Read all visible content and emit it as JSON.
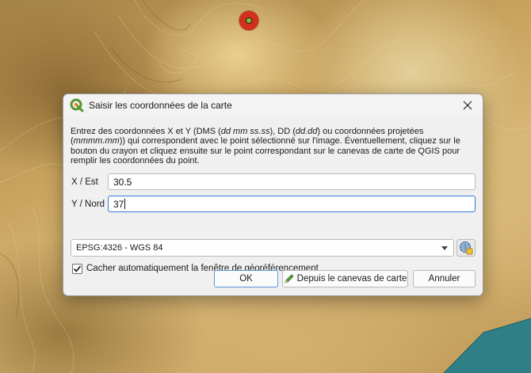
{
  "dialog": {
    "title": "Saisir les coordonnées de la carte",
    "description": {
      "p1": "Entrez des coordonnées X et Y (DMS (",
      "dms_format": "dd mm ss.ss",
      "p2": "), DD (",
      "dd_format": "dd.dd",
      "p3": ") ou coordonnées projetées (",
      "proj_format": "mmmm.mm",
      "p4": ")) qui correspondent avec le point sélectionné sur l'image. Éventuellement, cliquez sur le bouton du crayon et cliquez ensuite sur le point correspondant sur le canevas de carte de QGIS pour remplir les coordonnées du point."
    },
    "x_label": "X / Est",
    "x_value": "30.5",
    "y_label": "Y / Nord",
    "y_value": "37",
    "crs_selected": "EPSG:4326 - WGS 84",
    "hide_checkbox_label": "Cacher automatiquement la fenêtre de géoréférencement",
    "hide_checkbox_checked": true,
    "ok_label": "OK",
    "from_canvas_label": "Depuis le canevas de carte",
    "cancel_label": "Annuler"
  },
  "icons": {
    "app": "qgis-icon",
    "close": "close-icon",
    "crs": "projection-selector-icon",
    "pencil": "pencil-icon",
    "dropdown": "chevron-down-icon"
  },
  "colors": {
    "marker_outer": "#d2301f",
    "marker_inner": "#7ec13b",
    "water": "#2f7f86",
    "focus_border": "#2f7bd6"
  }
}
